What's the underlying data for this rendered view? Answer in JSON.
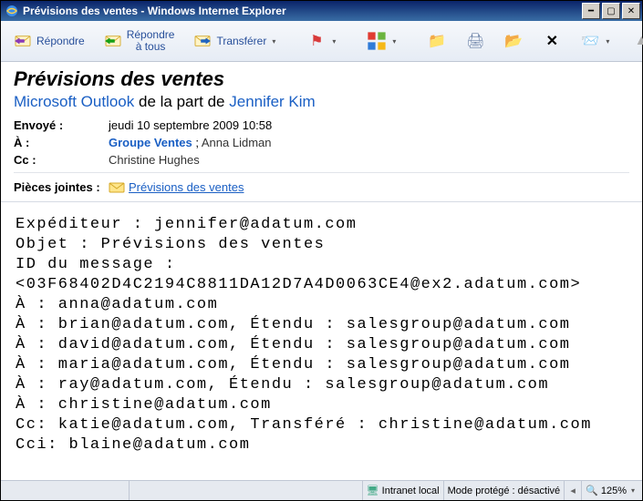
{
  "window": {
    "title": "Prévisions des ventes - Windows Internet Explorer"
  },
  "toolbar": {
    "reply": "Répondre",
    "reply_all": "Répondre\nà tous",
    "forward": "Transférer"
  },
  "header": {
    "subject": "Prévisions des ventes",
    "from_product": "Microsoft Outlook",
    "from_connector": " de la part de ",
    "from_person": "Jennifer Kim",
    "labels": {
      "sent": "Envoyé :",
      "to": "À :",
      "cc": "Cc :",
      "attachments": "Pièces jointes :"
    },
    "sent_value": "jeudi 10 septembre 2009 10:58",
    "to_group": "Groupe Ventes",
    "to_sep": " ; ",
    "to_person": "Anna Lidman",
    "cc_person": "Christine Hughes",
    "attachment_name": "Prévisions des ventes"
  },
  "body": "Expéditeur : jennifer@adatum.com\nObjet : Prévisions des ventes\nID du message : <03F68402D4C2194C8811DA12D7A4D0063CE4@ex2.adatum.com>\nÀ : anna@adatum.com\nÀ : brian@adatum.com, Étendu : salesgroup@adatum.com\nÀ : david@adatum.com, Étendu : salesgroup@adatum.com\nÀ : maria@adatum.com, Étendu : salesgroup@adatum.com\nÀ : ray@adatum.com, Étendu : salesgroup@adatum.com\nÀ : christine@adatum.com\nCc: katie@adatum.com, Transféré : christine@adatum.com\nCci: blaine@adatum.com",
  "statusbar": {
    "zone": "Intranet local",
    "protected_mode": "Mode protégé : désactivé",
    "zoom": "125%"
  }
}
